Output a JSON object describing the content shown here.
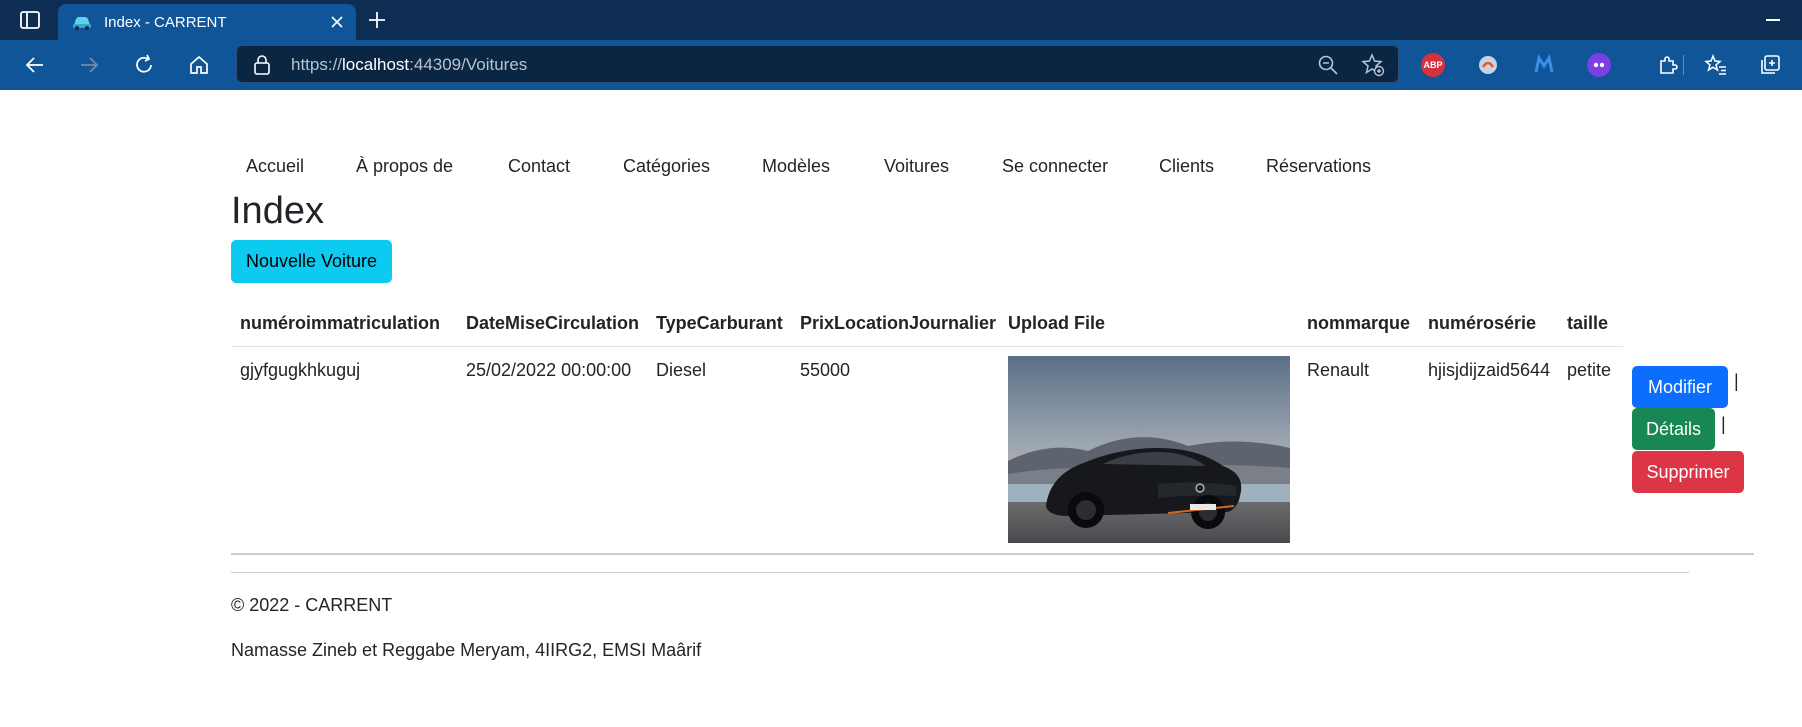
{
  "browser": {
    "tab_title": "Index - CARRENT",
    "url_scheme": "https://",
    "url_host": "localhost",
    "url_rest": ":44309/Voitures",
    "extensions": {
      "abp_label": "ABP"
    }
  },
  "nav": {
    "items": [
      "Accueil",
      "À propos de",
      "Contact",
      "Catégories",
      "Modèles",
      "Voitures",
      "Se connecter",
      "Clients",
      "Réservations"
    ]
  },
  "page": {
    "title": "Index",
    "new_button": "Nouvelle Voiture"
  },
  "table": {
    "headers": [
      "numéroimmatriculation",
      "DateMiseCirculation",
      "TypeCarburant",
      "PrixLocationJournalier",
      "Upload File",
      "nommarque",
      "numérosérie",
      "taille"
    ],
    "rows": [
      {
        "numeroimmatriculation": "gjyfgugkhkuguj",
        "date": "25/02/2022 00:00:00",
        "carburant": "Diesel",
        "prix": "55000",
        "marque": "Renault",
        "serie": "hjisjdijzaid5644",
        "taille": "petite",
        "actions": {
          "edit": "Modifier",
          "details": "Détails",
          "delete": "Supprimer",
          "separator": "|"
        }
      }
    ]
  },
  "footer": {
    "copyright": "© 2022 - CARRENT",
    "authors": "Namasse Zineb et Reggabe Meryam, 4IIRG2, EMSI Maârif"
  },
  "colors": {
    "info": "#0dcaf0",
    "primary": "#0d6efd",
    "success": "#198754",
    "danger": "#dc3545",
    "browser_frame": "#0d2e52",
    "browser_toolbar": "#0f5597"
  }
}
